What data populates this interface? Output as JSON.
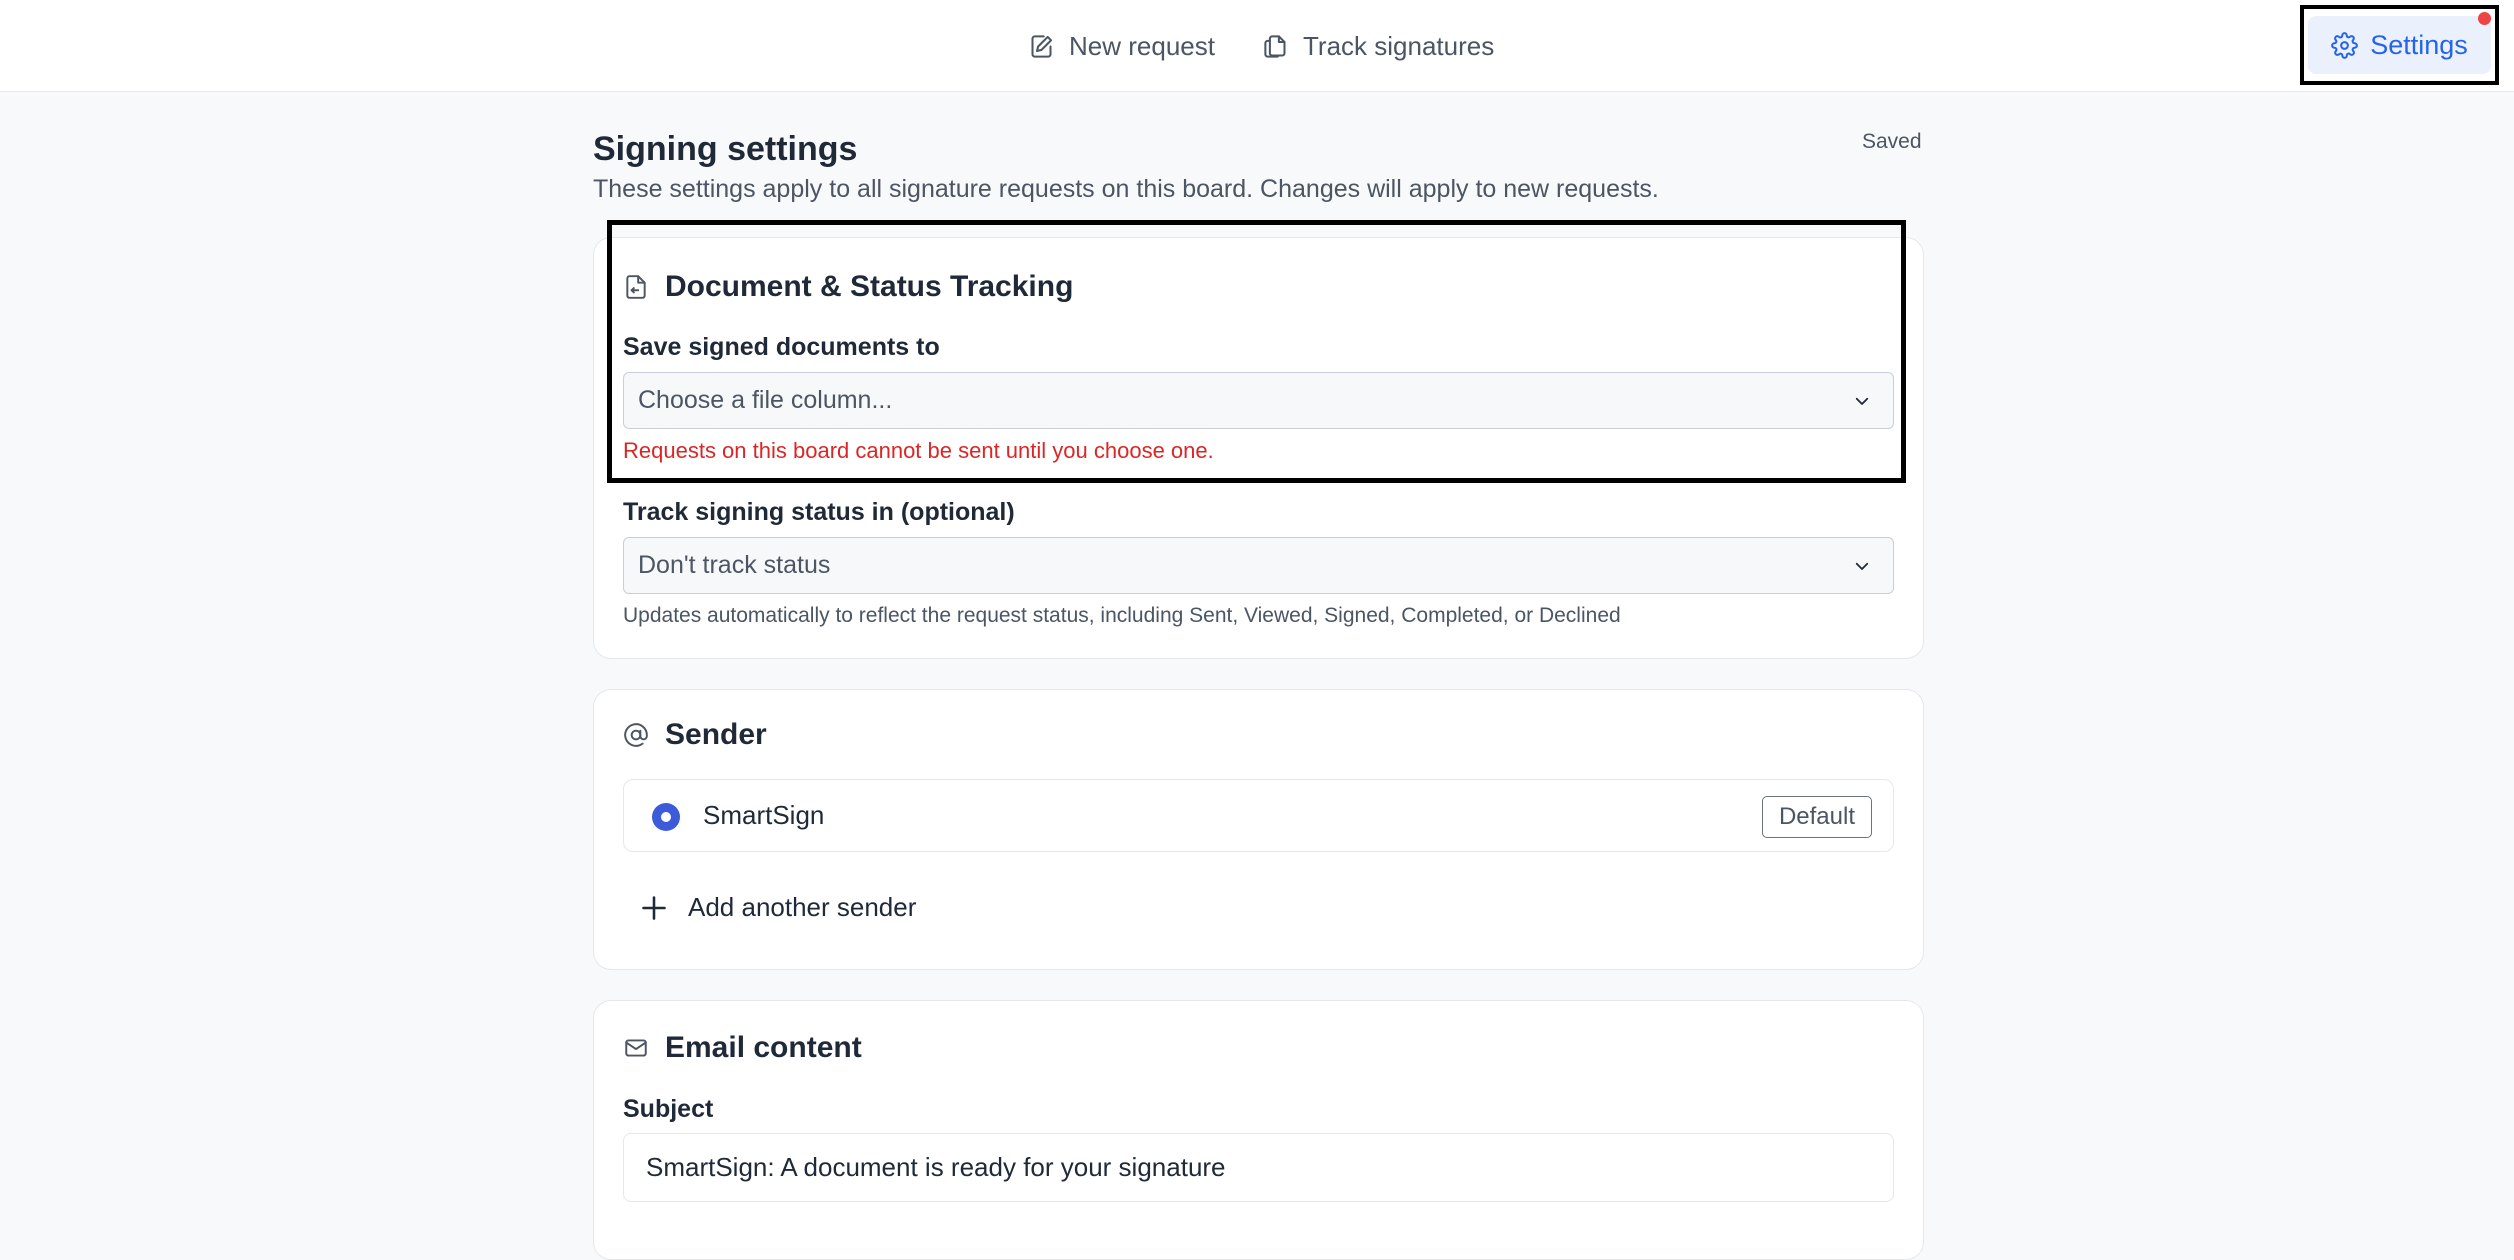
{
  "nav": {
    "new_request": "New request",
    "track_signatures": "Track signatures",
    "settings": "Settings"
  },
  "page": {
    "title": "Signing settings",
    "subtitle": "These settings apply to all signature requests on this board. Changes will apply to new requests.",
    "save_status": "Saved"
  },
  "document_card": {
    "title": "Document & Status Tracking",
    "save_label": "Save signed documents to",
    "save_placeholder": "Choose a file column...",
    "save_error": "Requests on this board cannot be sent until you choose one.",
    "status_label": "Track signing status in (optional)",
    "status_value": "Don't track status",
    "status_help": "Updates automatically to reflect the request status, including Sent, Viewed, Signed, Completed, or Declined"
  },
  "sender_card": {
    "title": "Sender",
    "sender_name": "SmartSign",
    "badge": "Default",
    "add_label": "Add another sender"
  },
  "email_card": {
    "title": "Email content",
    "subject_label": "Subject",
    "subject_value": "SmartSign: A document is ready for your signature"
  },
  "colors": {
    "accent": "#2563eb",
    "error": "#dc2626",
    "radio": "#3b5bdb",
    "notification": "#ef4444"
  },
  "icons": [
    "edit-document-icon",
    "copy-documents-icon",
    "gear-icon",
    "file-icon",
    "chevron-down-icon",
    "at-sign-icon",
    "plus-icon",
    "mail-icon"
  ]
}
